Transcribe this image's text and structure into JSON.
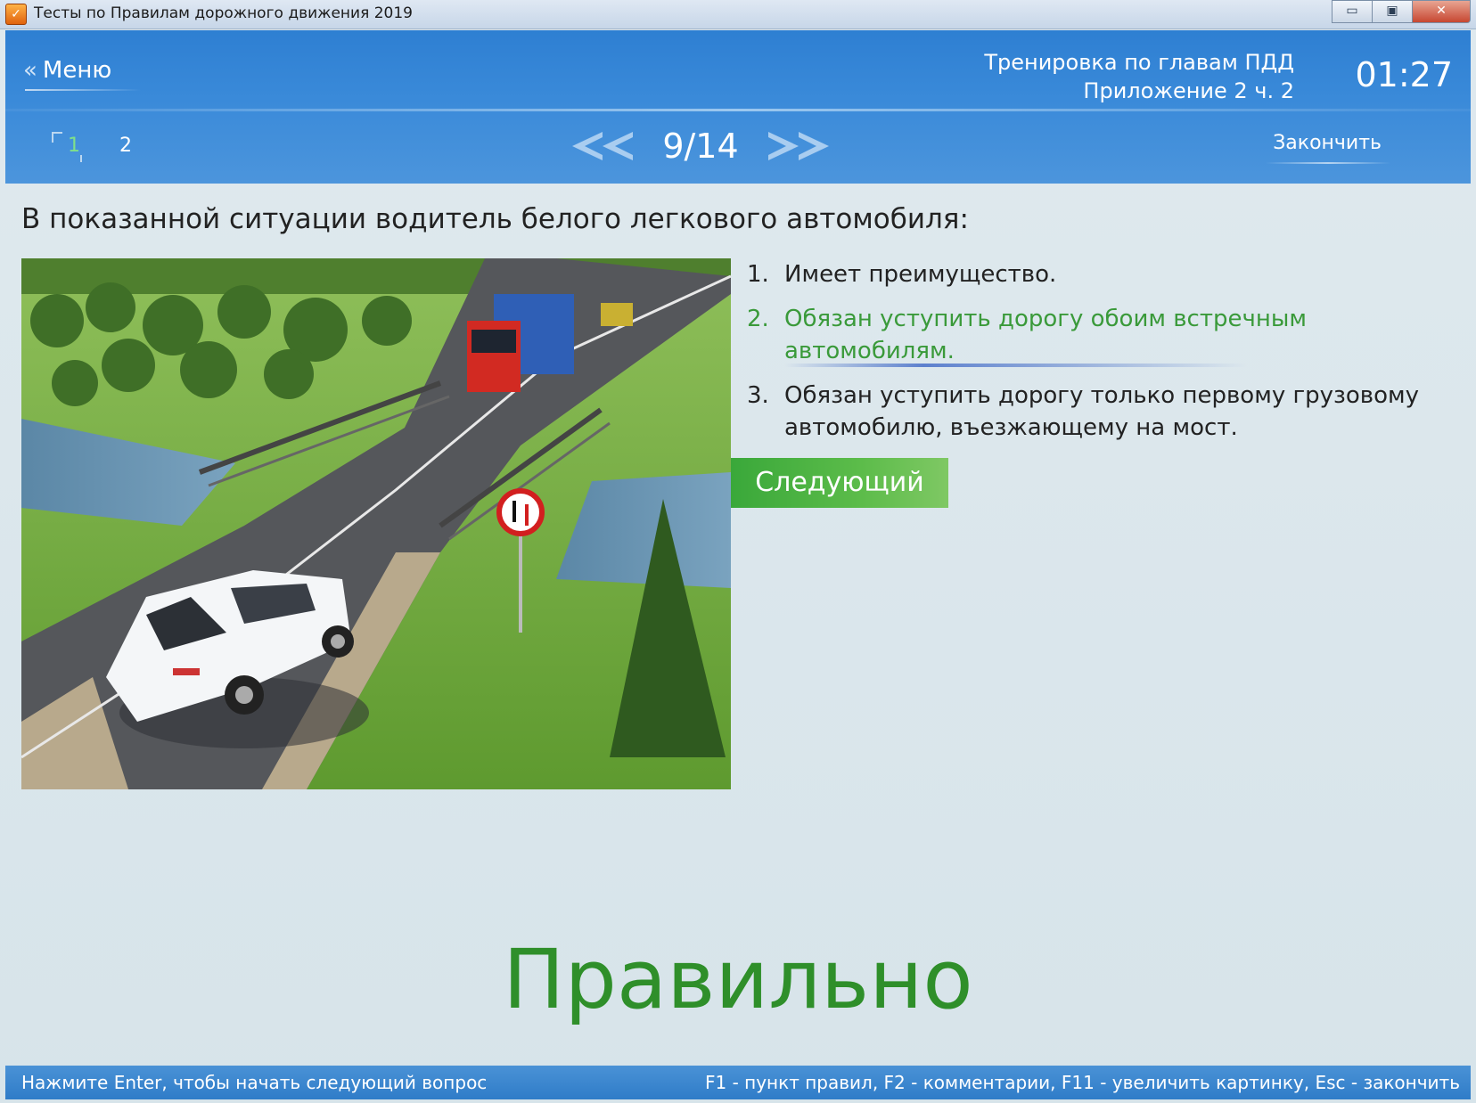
{
  "window": {
    "title": "Тесты по Правилам дорожного движения 2019",
    "controls": {
      "minimize": "▭",
      "maximize": "▣",
      "close": "✕"
    }
  },
  "header": {
    "menu_label": "Меню",
    "mode_line1": "Тренировка по главам ПДД",
    "mode_line2": "Приложение 2 ч. 2",
    "timer": "01:27",
    "sections": [
      "1",
      "2"
    ],
    "active_section": "1",
    "counter": "9/14",
    "finish_label": "Закончить"
  },
  "question": {
    "text": "В показанной ситуации водитель белого легкового автомобиля:",
    "answers": [
      {
        "num": "1.",
        "text": "Имеет преимущество."
      },
      {
        "num": "2.",
        "text": "Обязан уступить дорогу обоим встречным автомобилям."
      },
      {
        "num": "3.",
        "text": "Обязан уступить дорогу только первому грузовому автомобилю, въезжающему на мост."
      }
    ],
    "selected_answer": "2",
    "next_label": "Следующий"
  },
  "result_label": "Правильно",
  "status": {
    "left": "Нажмите Enter, чтобы начать следующий вопрос",
    "right": "F1 - пункт правил, F2 - комментарии, F11 - увеличить картинку, Esc - закончить"
  },
  "colors": {
    "header_blue": "#3a8ad9",
    "correct_green": "#3a9a3a",
    "next_button_green": "#5cbc4a",
    "result_green": "#2f8f2a"
  },
  "icons": {
    "menu_back": "double-chevron-left-icon",
    "prev": "double-chevron-left-icon",
    "next": "double-chevron-right-icon"
  }
}
